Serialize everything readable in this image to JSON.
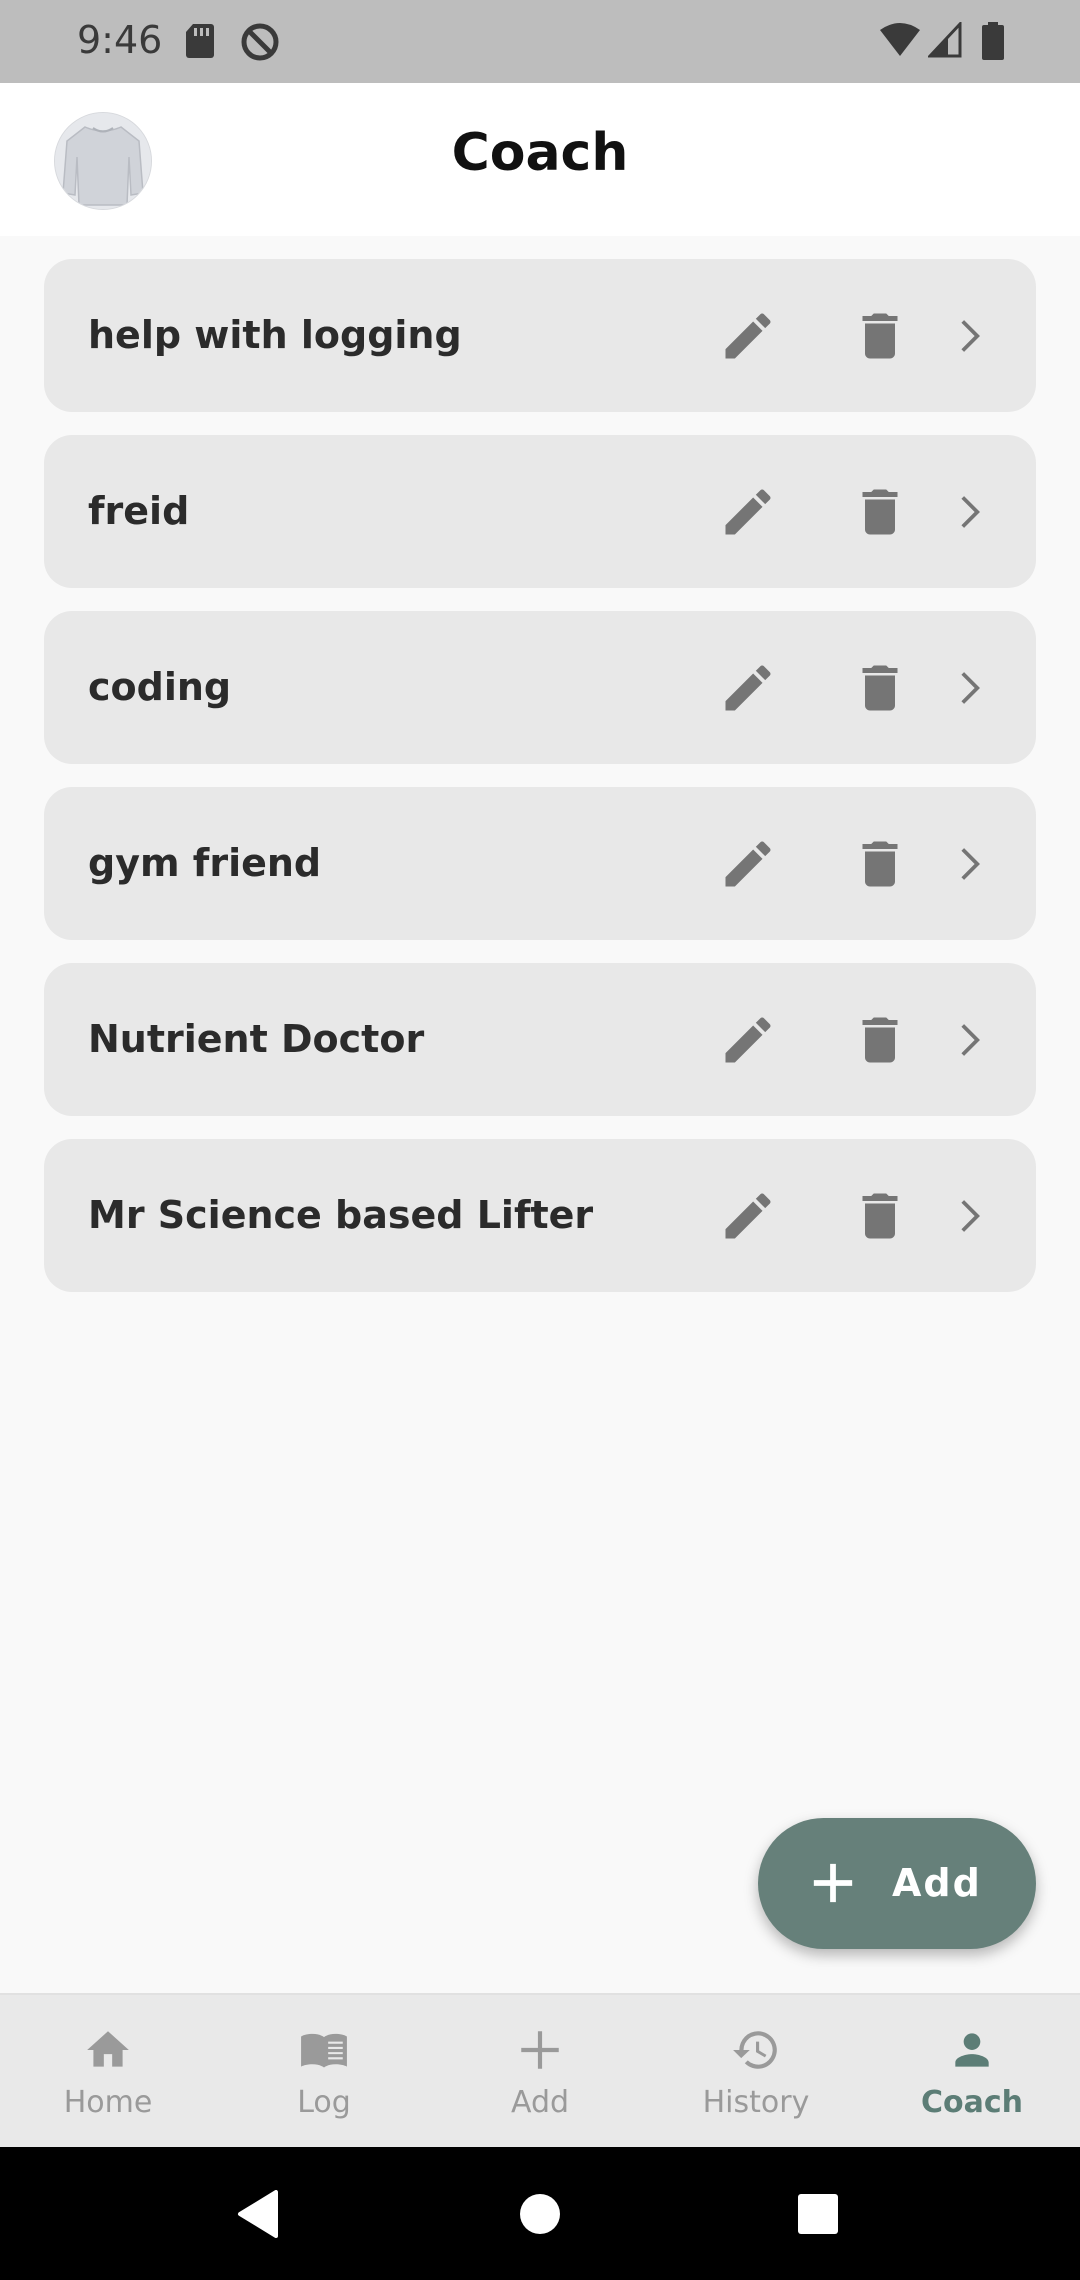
{
  "status_bar": {
    "time": "9:46"
  },
  "header": {
    "title": "Coach"
  },
  "coaches": [
    {
      "name": "help with logging"
    },
    {
      "name": "freid"
    },
    {
      "name": "coding"
    },
    {
      "name": "gym friend"
    },
    {
      "name": "Nutrient Doctor"
    },
    {
      "name": "Mr Science based Lifter"
    }
  ],
  "fab": {
    "label": "Add",
    "icon": "plus-icon"
  },
  "bottom_nav": {
    "items": [
      {
        "label": "Home",
        "icon": "home-icon"
      },
      {
        "label": "Log",
        "icon": "book-icon"
      },
      {
        "label": "Add",
        "icon": "plus-icon"
      },
      {
        "label": "History",
        "icon": "history-icon"
      },
      {
        "label": "Coach",
        "icon": "person-icon"
      }
    ],
    "active": "Coach"
  },
  "colors": {
    "accent": "#66807a",
    "active_nav": "#5c7d76",
    "card_bg": "#e8e8e8",
    "icon_gray": "#757575"
  }
}
